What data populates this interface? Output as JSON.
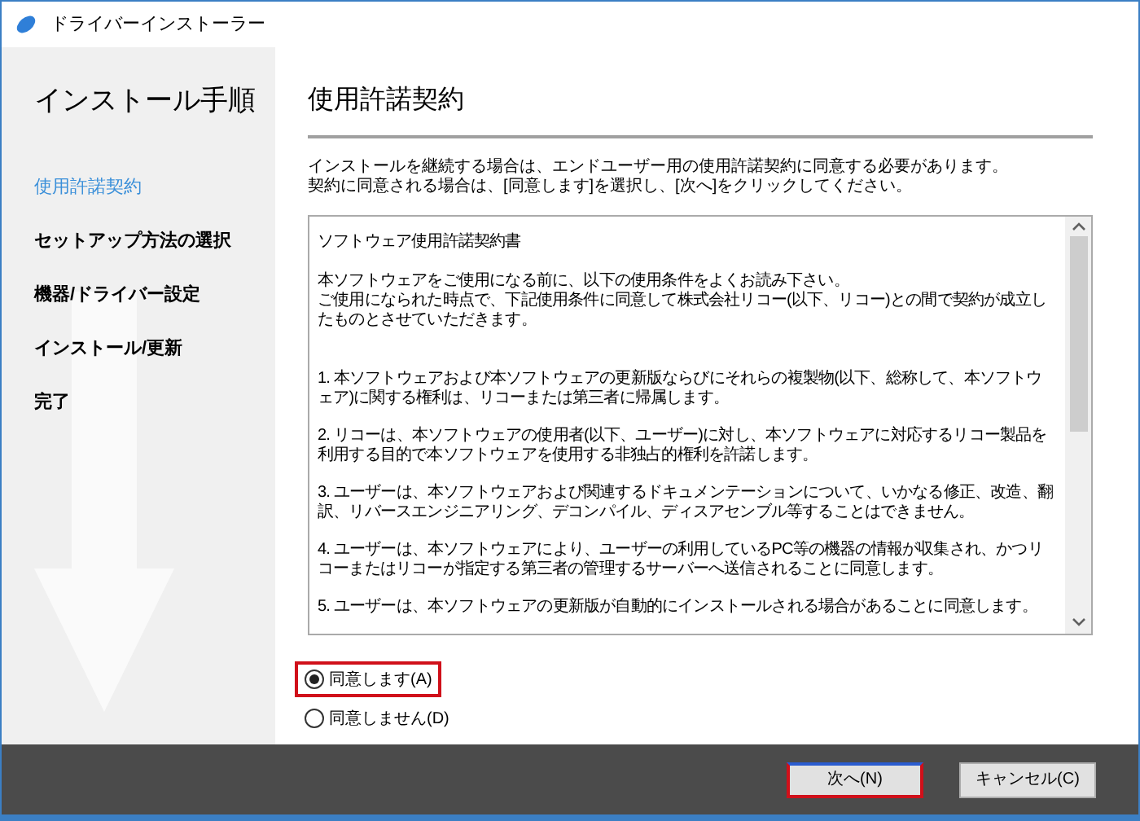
{
  "window": {
    "title": "ドライバーインストーラー"
  },
  "sidebar": {
    "title": "インストール手順",
    "items": [
      {
        "label": "使用許諾契約",
        "selected": true
      },
      {
        "label": "セットアップ方法の選択",
        "selected": false
      },
      {
        "label": "機器/ドライバー設定",
        "selected": false
      },
      {
        "label": "インストール/更新",
        "selected": false
      },
      {
        "label": "完了",
        "selected": false
      }
    ]
  },
  "content": {
    "heading": "使用許諾契約",
    "intro": [
      "インストールを継続する場合は、エンドユーザー用の使用許諾契約に同意する必要があります。",
      "契約に同意される場合は、[同意します]を選択し、[次へ]をクリックしてください。"
    ],
    "license": {
      "title": "ソフトウェア使用許諾契約書",
      "preamble": [
        "本ソフトウェアをご使用になる前に、以下の使用条件をよくお読み下さい。",
        "ご使用になられた時点で、下記使用条件に同意して株式会社リコー(以下、リコー)との間で契約が成立したものとさせていただきます。"
      ],
      "clauses": [
        "1. 本ソフトウェアおよび本ソフトウェアの更新版ならびにそれらの複製物(以下、総称して、本ソフトウェア)に関する権利は、リコーまたは第三者に帰属します。",
        "2. リコーは、本ソフトウェアの使用者(以下、ユーザー)に対し、本ソフトウェアに対応するリコー製品を利用する目的で本ソフトウェアを使用する非独占的権利を許諾します。",
        "3. ユーザーは、本ソフトウェアおよび関連するドキュメンテーションについて、いかなる修正、改造、翻訳、リバースエンジニアリング、デコンパイル、ディスアセンブル等することはできません。",
        "4. ユーザーは、本ソフトウェアにより、ユーザーの利用しているPC等の機器の情報が収集され、かつリコーまたはリコーが指定する第三者の管理するサーバーへ送信されることに同意します。",
        "5. ユーザーは、本ソフトウェアの更新版が自動的にインストールされる場合があることに同意します。"
      ]
    },
    "options": [
      {
        "label": "同意します(A)",
        "selected": true,
        "highlighted": true
      },
      {
        "label": "同意しません(D)",
        "selected": false,
        "highlighted": false
      }
    ]
  },
  "footer": {
    "buttons": [
      {
        "label": "次へ(N)",
        "kind": "primary",
        "highlighted": true
      },
      {
        "label": "キャンセル(C)",
        "kind": "secondary",
        "highlighted": false
      }
    ]
  }
}
